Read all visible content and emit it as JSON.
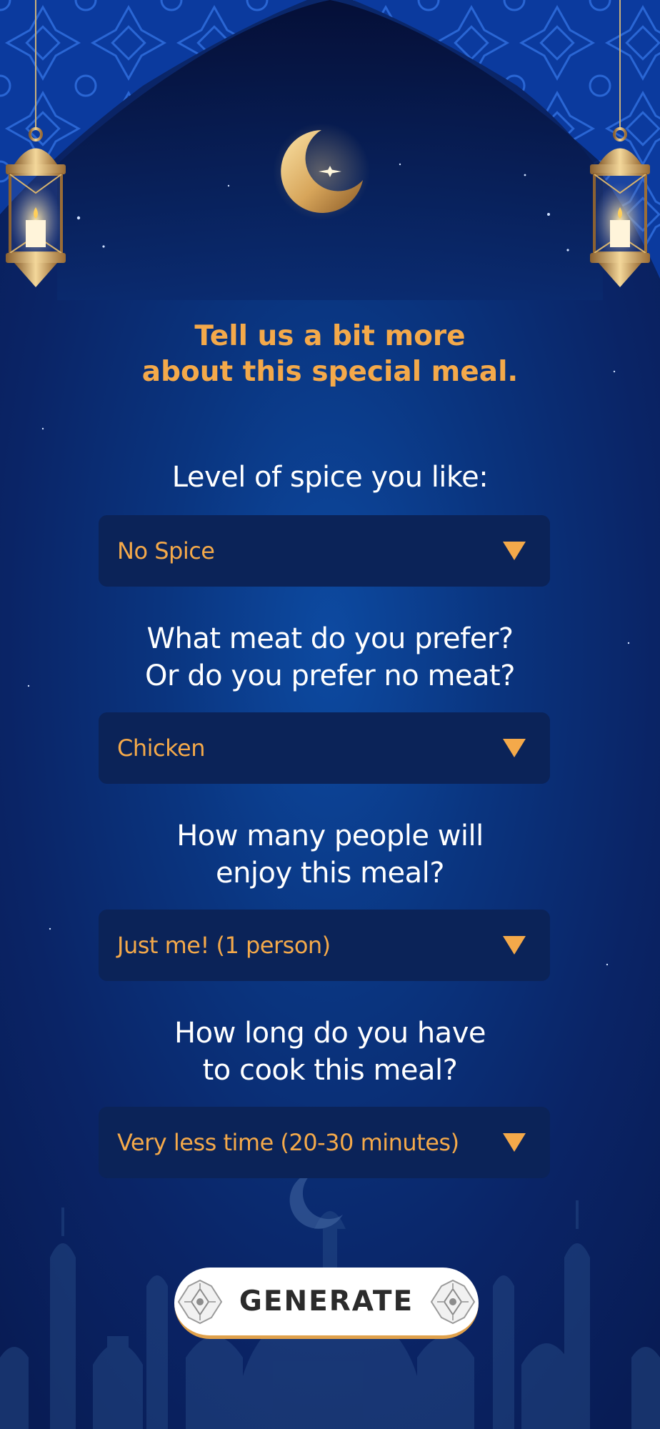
{
  "header": {
    "title": "Tell us a bit more\nabout this special meal."
  },
  "questions": [
    {
      "label": "Level of spice you like:",
      "selected": "No Spice"
    },
    {
      "label": "What meat do you prefer?\nOr do you prefer no meat?",
      "selected": "Chicken"
    },
    {
      "label": "How many people will\nenjoy this meal?",
      "selected": "Just me! (1 person)"
    },
    {
      "label": "How long do you have\nto cook this meal?",
      "selected": "Very less time (20-30 minutes)"
    }
  ],
  "actions": {
    "generate_label": "GENERATE"
  },
  "icons": {
    "lantern": "lantern-icon",
    "moon": "crescent-moon-icon",
    "dropdown": "chevron-down-icon",
    "ornament": "ornament-icon",
    "skyline": "mosque-skyline-icon"
  },
  "colors": {
    "accent": "#f4a94a",
    "select_bg": "#0b2358",
    "text": "#ffffff",
    "button_bg": "#ffffff",
    "button_text": "#2b2b2b"
  }
}
